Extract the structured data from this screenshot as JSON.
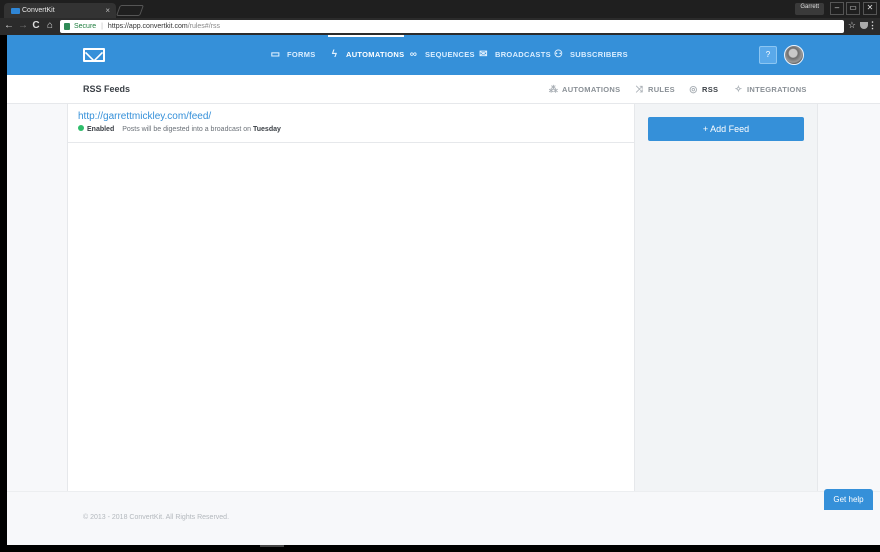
{
  "browser": {
    "tab_title": "ConvertKit",
    "tab_close": "×",
    "profile_name": "Garrett",
    "window_controls": [
      "–",
      "▭",
      "✕"
    ],
    "nav": {
      "back": "←",
      "forward": "→",
      "reload": "C",
      "home": "⌂"
    },
    "address": {
      "secure_label": "Secure",
      "host": "https://app.convertkit.com",
      "path": "/rules#/rss"
    },
    "star": "☆",
    "menu": "⋮"
  },
  "topnav": {
    "items": [
      {
        "label": "FORMS",
        "icon": "form-icon",
        "glyph": "▭",
        "active": false
      },
      {
        "label": "AUTOMATIONS",
        "icon": "lightning-icon",
        "glyph": "ϟ",
        "active": true
      },
      {
        "label": "SEQUENCES",
        "icon": "sequence-icon",
        "glyph": "∞",
        "active": false
      },
      {
        "label": "BROADCASTS",
        "icon": "envelope-icon",
        "glyph": "✉",
        "active": false
      },
      {
        "label": "SUBSCRIBERS",
        "icon": "people-icon",
        "glyph": "⚇",
        "active": false
      }
    ],
    "help_label": "?"
  },
  "subheader": {
    "title": "RSS Feeds",
    "items": [
      {
        "label": "AUTOMATIONS",
        "icon": "flow-icon",
        "glyph": "⁂",
        "active": false
      },
      {
        "label": "RULES",
        "icon": "shuffle-icon",
        "glyph": "⤨",
        "active": false
      },
      {
        "label": "RSS",
        "icon": "rss-icon",
        "glyph": "◎",
        "active": true
      },
      {
        "label": "INTEGRATIONS",
        "icon": "puzzle-icon",
        "glyph": "✧",
        "active": false
      }
    ]
  },
  "feeds": [
    {
      "url": "http://garrettmickley.com/feed/",
      "status": "Enabled",
      "description": "Posts will be digested into a broadcast on",
      "day": "Tuesday"
    }
  ],
  "add_feed_label": "+ Add Feed",
  "footer": {
    "copyright": "© 2013 - 2018 ConvertKit. All Rights Reserved."
  },
  "get_help_label": "Get help",
  "colors": {
    "brand": "#3590d9",
    "enabled": "#2ebd6b"
  }
}
